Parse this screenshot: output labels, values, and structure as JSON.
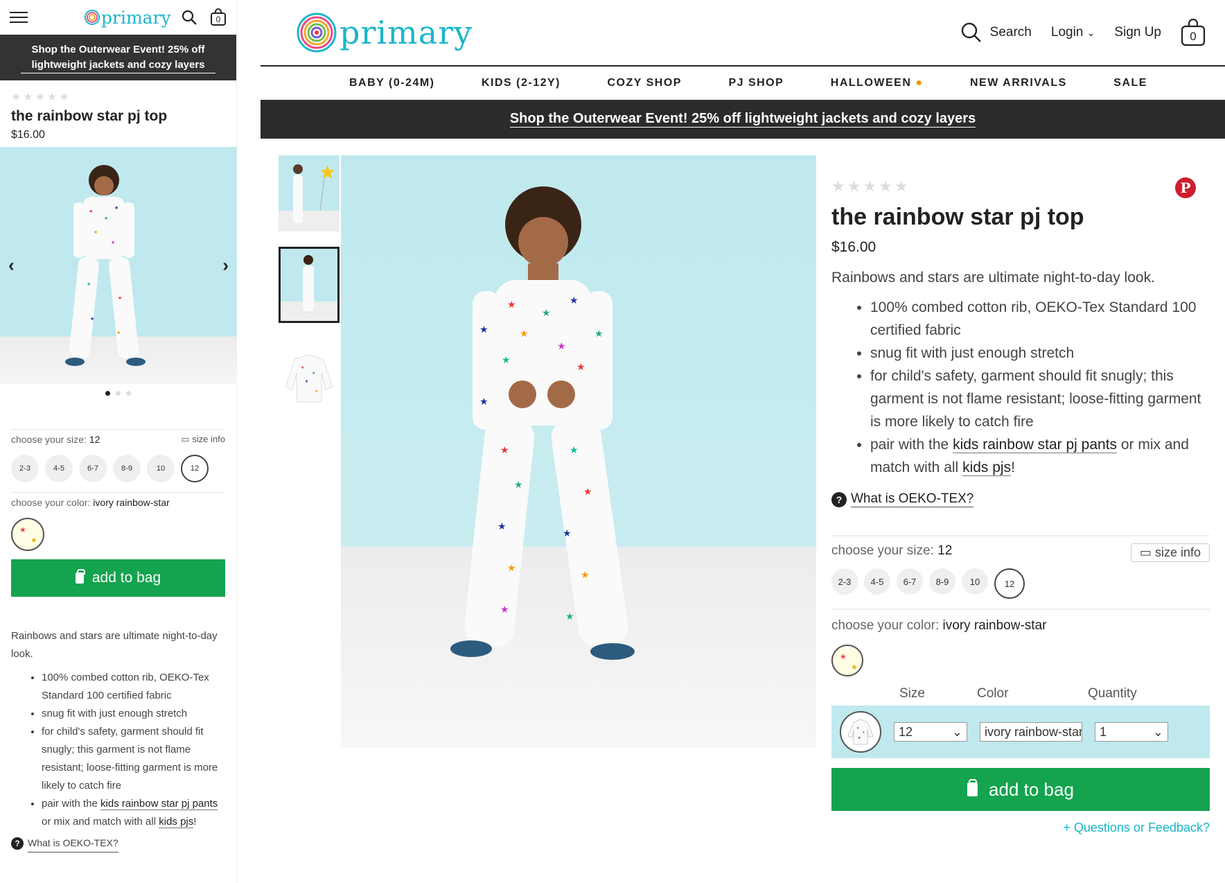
{
  "brand": {
    "name": "primary"
  },
  "promo": {
    "text": "Shop the Outerwear Event! 25% off lightweight jackets and cozy layers"
  },
  "product": {
    "title": "the rainbow star pj top",
    "price": "$16.00",
    "rating": 0,
    "description": "Rainbows and stars are ultimate night-to-day look.",
    "bullets": {
      "b1": "100% combed cotton rib, OEKO-Tex Standard 100 certified fabric",
      "b2": "snug fit with just enough stretch",
      "b3": "for child's safety, garment should fit snugly; this garment is not flame resistant; loose-fitting garment is more likely to catch fire",
      "b4_pre": "pair with the",
      "b4_link1": "kids rainbow star pj pants",
      "b4_mid": "or mix and match with all",
      "b4_link2": "kids pjs",
      "b4_post": "!"
    },
    "oeko_link": "What is OEKO-TEX?"
  },
  "size": {
    "label": "choose your size:",
    "selected": "12",
    "size_info": "size info",
    "options": [
      "2-3",
      "4-5",
      "6-7",
      "8-9",
      "10",
      "12"
    ]
  },
  "color": {
    "label": "choose your color:",
    "selected": "ivory rainbow-star"
  },
  "cart_row": {
    "headers": {
      "size": "Size",
      "color": "Color",
      "quantity": "Quantity"
    },
    "size_value": "12",
    "color_value": "ivory rainbow-star",
    "quantity_value": "1"
  },
  "actions": {
    "add_to_bag": "add to bag",
    "feedback": "+ Questions or Feedback?"
  },
  "header": {
    "search": "Search",
    "login": "Login",
    "signup": "Sign Up",
    "cart_count": "0"
  },
  "nav": {
    "baby": "BABY (0-24M)",
    "kids": "KIDS (2-12Y)",
    "cozy": "COZY SHOP",
    "pj": "PJ SHOP",
    "halloween": "HALLOWEEN",
    "new": "NEW ARRIVALS",
    "sale": "SALE"
  },
  "colors": {
    "accent": "#1bb6c9",
    "cta": "#14a34e",
    "banner": "#2b2b2b",
    "hero_bg": "#bfe9ee"
  },
  "icons": [
    "hamburger-icon",
    "search-icon",
    "bag-icon",
    "chevron-left-icon",
    "chevron-right-icon",
    "ruler-icon",
    "question-icon",
    "pinterest-icon",
    "pumpkin-icon",
    "chevron-down-icon"
  ]
}
